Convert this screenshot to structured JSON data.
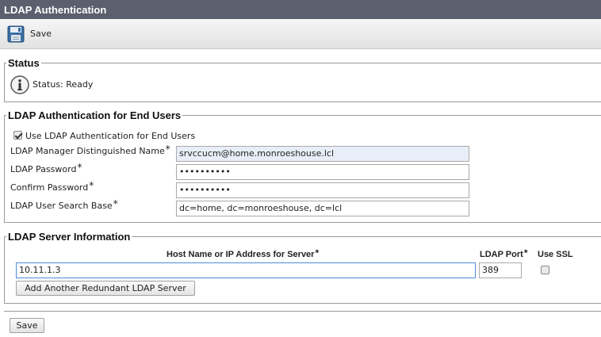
{
  "page": {
    "title": "LDAP Authentication"
  },
  "toolbar": {
    "save_label": "Save"
  },
  "status": {
    "legend": "Status",
    "text": "Status: Ready"
  },
  "end_users": {
    "legend": "LDAP Authentication for End Users",
    "use_ldap_label": "Use LDAP Authentication for End Users",
    "use_ldap_checked": true,
    "manager_dn_label": "LDAP Manager Distinguished Name",
    "manager_dn_value": "srvccucm@home.monroeshouse.lcl",
    "password_label": "LDAP Password",
    "password_value": "••••••••••",
    "confirm_label": "Confirm Password",
    "confirm_value": "••••••••••",
    "search_base_label": "LDAP User Search Base",
    "search_base_value": "dc=home, dc=monroeshouse, dc=lcl",
    "required_mark": "*"
  },
  "server_info": {
    "legend": "LDAP Server Information",
    "host_header": "Host Name or IP Address for Server",
    "port_header": "LDAP Port",
    "ssl_header": "Use SSL",
    "host_value": "10.11.1.3",
    "port_value": "389",
    "use_ssl_checked": false,
    "add_server_label": "Add Another Redundant LDAP Server",
    "required_mark": "*"
  },
  "footer": {
    "save_label": "Save"
  },
  "colors": {
    "title_bar": "#5b5f6e",
    "focus_border": "#4d8cd9",
    "autofill_bg": "#e8eef8"
  },
  "icons": {
    "save": "floppy-disk-icon",
    "status": "info-icon"
  }
}
